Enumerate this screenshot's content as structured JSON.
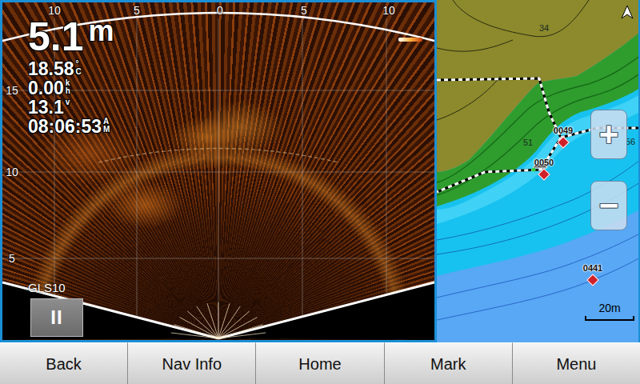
{
  "sonar": {
    "top_ticks": [
      "10",
      "5",
      "0",
      "5",
      "10"
    ],
    "side_ticks": [
      "15",
      "10",
      "5"
    ],
    "readings": [
      {
        "value": "5.1",
        "unit": [
          "m"
        ],
        "kind": "depth"
      },
      {
        "value": "18.58",
        "unit": [
          "°",
          "C"
        ],
        "kind": "stat"
      },
      {
        "value": "0.00",
        "unit": [
          "k",
          "h"
        ],
        "kind": "stat"
      },
      {
        "value": "13.1",
        "unit": [
          "v"
        ],
        "kind": "stat"
      },
      {
        "value": "08:06:53",
        "unit": [
          "A",
          "M"
        ],
        "kind": "stat"
      }
    ],
    "source": "GLS10",
    "pause_label": "II"
  },
  "map": {
    "waypoints": [
      {
        "label": "0049"
      },
      {
        "label": "0050"
      },
      {
        "label": "0441"
      }
    ],
    "depth_labels": [
      "34",
      "51",
      "56"
    ],
    "zoom_in": "+",
    "zoom_out": "−",
    "scale": "20m"
  },
  "toolbar": {
    "buttons": [
      {
        "label": "Back"
      },
      {
        "label": "Nav Info"
      },
      {
        "label": "Home"
      },
      {
        "label": "Mark"
      },
      {
        "label": "Menu"
      }
    ]
  }
}
